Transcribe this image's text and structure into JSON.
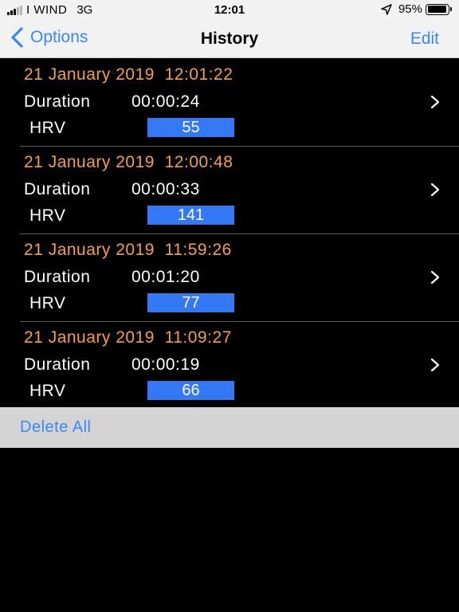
{
  "status_bar": {
    "carrier": "I WIND",
    "network": "3G",
    "time": "12:01",
    "battery_percent": "95%",
    "battery_level": 0.95,
    "signal_bars_filled": 3,
    "signal_bars_total": 5,
    "icons": [
      "signal-bars-icon",
      "location-arrow-icon",
      "battery-icon"
    ]
  },
  "nav": {
    "back_label": "Options",
    "title": "History",
    "edit_label": "Edit",
    "icons": [
      "chevron-left-icon"
    ]
  },
  "sessions": [
    {
      "date": "21 January 2019  12:01:22",
      "duration_label": "Duration",
      "duration": "00:00:24",
      "hrv_label": "HRV",
      "hrv": "55"
    },
    {
      "date": "21 January 2019  12:00:48",
      "duration_label": "Duration",
      "duration": "00:00:33",
      "hrv_label": "HRV",
      "hrv": "141"
    },
    {
      "date": "21 January 2019  11:59:26",
      "duration_label": "Duration",
      "duration": "00:01:20",
      "hrv_label": "HRV",
      "hrv": "77"
    },
    {
      "date": "21 January 2019  11:09:27",
      "duration_label": "Duration",
      "duration": "00:00:19",
      "hrv_label": "HRV",
      "hrv": "66"
    }
  ],
  "footer": {
    "delete_all_label": "Delete All"
  },
  "colors": {
    "accent_blue": "#3a88f5",
    "hrv_badge": "#3478f6",
    "date_orange": "#f0a050",
    "background": "#000000",
    "bar_background": "#f2f2f2"
  }
}
